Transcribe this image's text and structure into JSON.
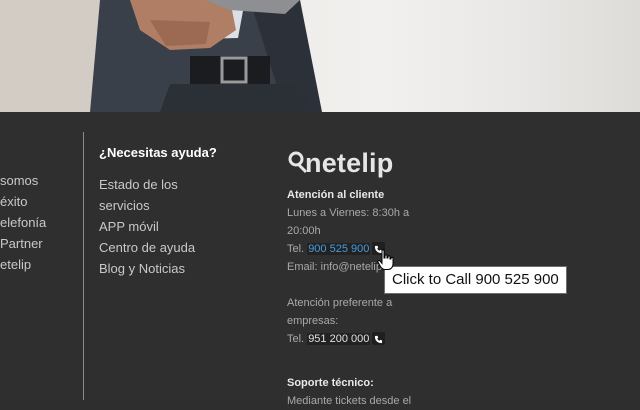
{
  "footer_links": [
    "somos",
    "éxito",
    "elefonía",
    " Partner",
    "etelip"
  ],
  "help": {
    "title": "¿Necesitas ayuda?",
    "links": [
      "Estado de los servicios",
      "APP móvil",
      "Centro de ayuda",
      "Blog y Noticias"
    ]
  },
  "brand": {
    "name": "netelip"
  },
  "contact": {
    "customer_title": "Atención al cliente",
    "hours": "Lunes a Viernes: 8:30h a 20:00h",
    "tel_label": "Tel.",
    "tel_number": "900 525 900",
    "email_label": "Email:",
    "email_value": "info@netelip",
    "business_title": "Atención preferente a empresas:",
    "business_tel_label": "Tel.",
    "business_tel_number": "951 200 000",
    "support_title": "Soporte técnico:",
    "support_text": "Mediante tickets desde el"
  },
  "tooltip": {
    "text": "Click to Call 900 525 900"
  },
  "colors": {
    "background": "#2f2f2f",
    "link": "#4a9bdc",
    "text": "#c9c9c9"
  }
}
